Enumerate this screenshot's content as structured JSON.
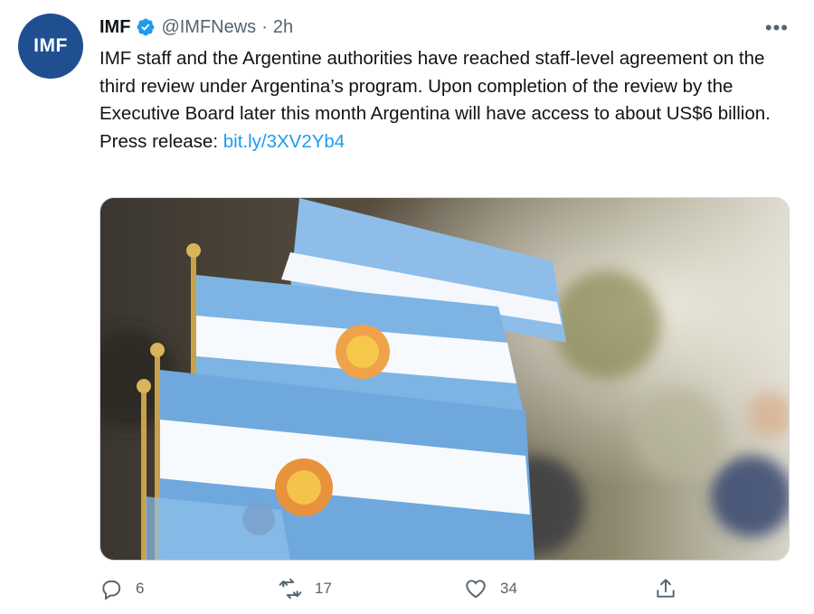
{
  "user": {
    "avatar_text": "IMF",
    "name": "IMF",
    "handle": "@IMFNews",
    "separator": "·",
    "time": "2h"
  },
  "tweet": {
    "text": "IMF staff and the Argentine authorities have reached staff-level agreement on the third review under Argentina’s program. Upon completion of the review by the Executive Board later this month Argentina will have access to about US$6 billion.",
    "press_label": "Press release: ",
    "press_link": "bit.ly/3XV2Yb4"
  },
  "media": {
    "description_icon": "argentine-flags-photo"
  },
  "actions": {
    "replies": "6",
    "retweets": "17",
    "likes": "34"
  },
  "colors": {
    "accent": "#1d9bf0",
    "avatar_bg": "#1f4f91",
    "flag_blue": "#74acdf"
  }
}
